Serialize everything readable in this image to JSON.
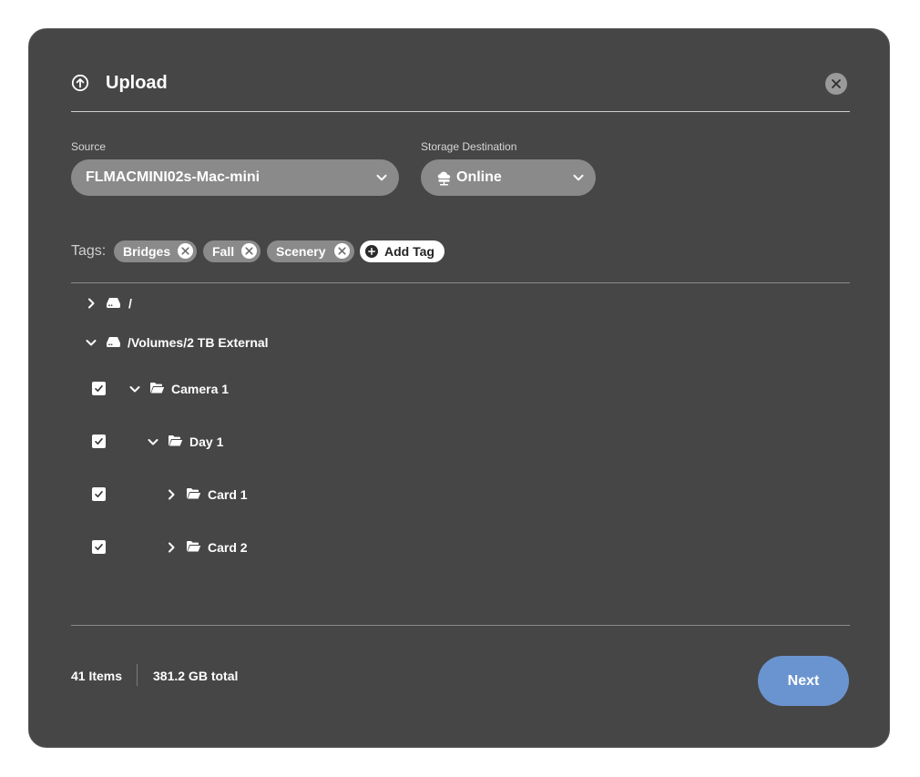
{
  "dialog": {
    "title": "Upload",
    "header_icon": "upload-circle-icon",
    "close_icon": "close-icon"
  },
  "source": {
    "label": "Source",
    "value": "FLMACMINI02s-Mac-mini"
  },
  "destination": {
    "label": "Storage Destination",
    "value": "Online",
    "icon": "cloud-server-icon"
  },
  "tags": {
    "label": "Tags:",
    "items": [
      "Bridges",
      "Fall",
      "Scenery"
    ],
    "add_label": "Add Tag"
  },
  "tree": {
    "nodes": [
      {
        "label": "/",
        "icon": "drive-icon",
        "expanded": false,
        "checked": null
      },
      {
        "label": "/Volumes/2 TB External",
        "icon": "drive-icon",
        "expanded": true,
        "checked": null
      },
      {
        "label": "Camera 1",
        "icon": "folder-open-icon",
        "expanded": true,
        "checked": true
      },
      {
        "label": "Day 1",
        "icon": "folder-open-icon",
        "expanded": true,
        "checked": true
      },
      {
        "label": "Card 1",
        "icon": "folder-open-icon",
        "expanded": false,
        "checked": true
      },
      {
        "label": "Card 2",
        "icon": "folder-open-icon",
        "expanded": false,
        "checked": true
      }
    ]
  },
  "footer": {
    "items_count": "41 Items",
    "total_size": "381.2 GB total",
    "next_label": "Next"
  },
  "colors": {
    "dialog_bg": "#464646",
    "pill_bg": "#8a8a8a",
    "accent": "#6a94d0"
  }
}
